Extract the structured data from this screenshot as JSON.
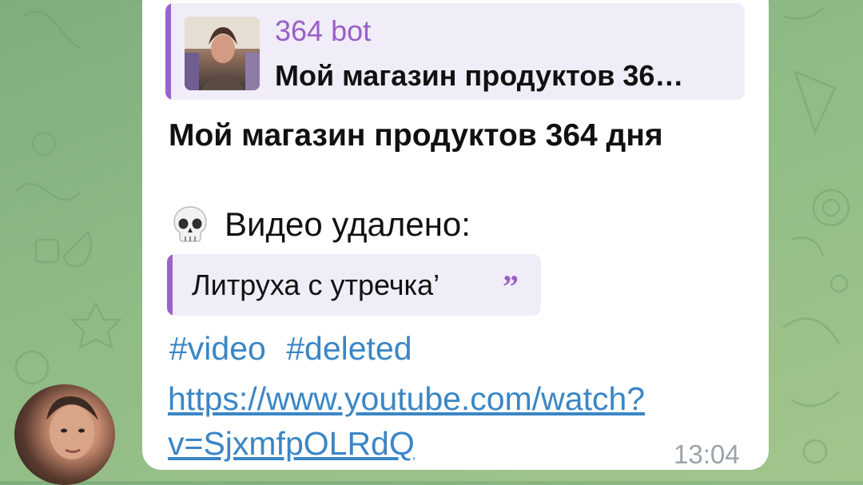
{
  "reply": {
    "sender": "364 bot",
    "preview": "Мой магазин продуктов 36…"
  },
  "message": {
    "title": "Мой магазин продуктов 364 дня",
    "status_text": "Видео удалено:",
    "quote": "Литруха с утречка’",
    "hashtags": [
      "#video",
      "#deleted"
    ],
    "link": "https://www.youtube.com/watch?v=SjxmfpOLRdQ",
    "time": "13:04"
  },
  "icons": {
    "status_icon": "skull-icon",
    "quote_icon": "quote-icon"
  },
  "colors": {
    "accent": "#9a5fc6",
    "link": "#3a86c6",
    "bubble": "#ffffff",
    "quote_bg": "#f0ecf8"
  }
}
